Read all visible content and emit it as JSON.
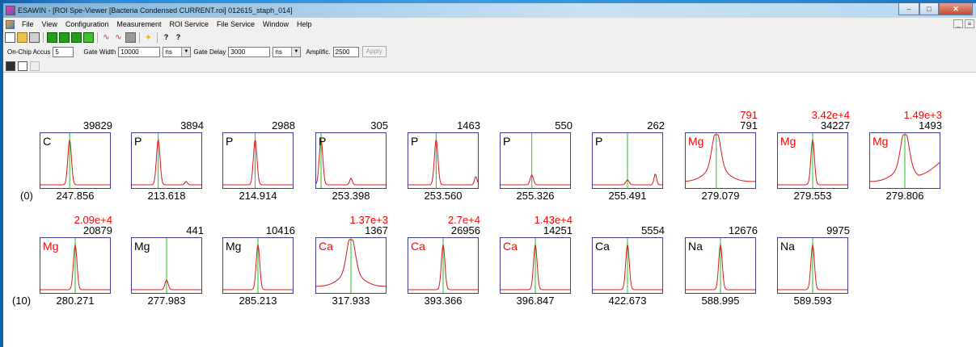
{
  "window": {
    "title": "ESAWIN - [ROI Spe-Viewer [Bacteria Condensed CURRENT.roi] 012615_staph_014]"
  },
  "menu": [
    "File",
    "View",
    "Configuration",
    "Measurement",
    "ROI Service",
    "File Service",
    "Window",
    "Help"
  ],
  "params": {
    "accus_label": "On-Chip Accus",
    "accus_value": "5",
    "gate_width_label": "Gate Width",
    "gate_width_value": "10000",
    "gate_width_unit": "ns",
    "gate_delay_label": "Gate Delay",
    "gate_delay_value": "3000",
    "gate_delay_unit": "ns",
    "amplific_label": "Amplific.",
    "amplific_value": "2500",
    "apply_label": "Apply"
  },
  "toolbar_icons": [
    "new-icon",
    "open-icon",
    "print-icon",
    "green-acquire-icon",
    "green-stop-icon",
    "green-step-icon",
    "green-plus-icon",
    "spectrum-icon",
    "spectrum-red-icon",
    "gray-square-icon",
    "yellow-star-icon",
    "help-icon",
    "context-help-icon"
  ],
  "rows": [
    {
      "label": "(0)",
      "cells": [
        {
          "element": "C",
          "element_color": "#000000",
          "count": "39829",
          "red": "",
          "wavelength": "247.856",
          "peak": 0.42,
          "shape": "sharp",
          "extra": []
        },
        {
          "element": "P",
          "element_color": "#000000",
          "count": "3894",
          "red": "",
          "wavelength": "213.618",
          "peak": 0.38,
          "shape": "sharp",
          "extra": [
            [
              0.78,
              0.06
            ]
          ]
        },
        {
          "element": "P",
          "element_color": "#000000",
          "count": "2988",
          "red": "",
          "wavelength": "214.914",
          "peak": 0.46,
          "shape": "sharp",
          "extra": []
        },
        {
          "element": "P",
          "element_color": "#000000",
          "count": "305",
          "red": "",
          "wavelength": "253.398",
          "peak": 0.07,
          "shape": "sharp",
          "extra": [
            [
              0.5,
              0.12
            ]
          ]
        },
        {
          "element": "P",
          "element_color": "#000000",
          "count": "1463",
          "red": "",
          "wavelength": "253.560",
          "peak": 0.4,
          "shape": "sharp",
          "extra": [
            [
              0.97,
              0.15
            ]
          ]
        },
        {
          "element": "P",
          "element_color": "#000000",
          "count": "550",
          "red": "",
          "wavelength": "255.326",
          "peak": 0.45,
          "shape": "small",
          "extra": []
        },
        {
          "element": "P",
          "element_color": "#000000",
          "count": "262",
          "red": "",
          "wavelength": "255.491",
          "peak": 0.5,
          "shape": "tiny",
          "extra": [
            [
              0.9,
              0.2
            ]
          ]
        },
        {
          "element": "Mg",
          "element_color": "#ff0000",
          "count": "791",
          "red": "791",
          "wavelength": "279.079",
          "peak": 0.44,
          "shape": "broad",
          "extra": []
        },
        {
          "element": "Mg",
          "element_color": "#ff0000",
          "count": "34227",
          "red": "3.42e+4",
          "wavelength": "279.553",
          "peak": 0.5,
          "shape": "sharp",
          "extra": []
        },
        {
          "element": "Mg",
          "element_color": "#ff0000",
          "count": "1493",
          "red": "1.49e+3",
          "wavelength": "279.806",
          "peak": 0.5,
          "shape": "broad",
          "extra": []
        }
      ]
    },
    {
      "label": "(10)",
      "cells": [
        {
          "element": "Mg",
          "element_color": "#ff0000",
          "count": "20879",
          "red": "2.09e+4",
          "wavelength": "280.271",
          "peak": 0.5,
          "shape": "sharp",
          "extra": []
        },
        {
          "element": "Mg",
          "element_color": "#000000",
          "count": "441",
          "red": "",
          "wavelength": "277.983",
          "peak": 0.5,
          "shape": "small",
          "extra": []
        },
        {
          "element": "Mg",
          "element_color": "#000000",
          "count": "10416",
          "red": "",
          "wavelength": "285.213",
          "peak": 0.5,
          "shape": "sharp",
          "extra": []
        },
        {
          "element": "Ca",
          "element_color": "#ff0000",
          "count": "1367",
          "red": "1.37e+3",
          "wavelength": "317.933",
          "peak": 0.5,
          "shape": "broad",
          "extra": []
        },
        {
          "element": "Ca",
          "element_color": "#ff0000",
          "count": "26956",
          "red": "2.7e+4",
          "wavelength": "393.366",
          "peak": 0.5,
          "shape": "sharp",
          "extra": []
        },
        {
          "element": "Ca",
          "element_color": "#ff0000",
          "count": "14251",
          "red": "1.43e+4",
          "wavelength": "396.847",
          "peak": 0.5,
          "shape": "sharp",
          "extra": []
        },
        {
          "element": "Ca",
          "element_color": "#000000",
          "count": "5554",
          "red": "",
          "wavelength": "422.673",
          "peak": 0.5,
          "shape": "sharp",
          "extra": []
        },
        {
          "element": "Na",
          "element_color": "#000000",
          "count": "12676",
          "red": "",
          "wavelength": "588.995",
          "peak": 0.5,
          "shape": "sharp",
          "extra": []
        },
        {
          "element": "Na",
          "element_color": "#000000",
          "count": "9975",
          "red": "",
          "wavelength": "589.593",
          "peak": 0.5,
          "shape": "sharp",
          "extra": []
        }
      ]
    }
  ]
}
